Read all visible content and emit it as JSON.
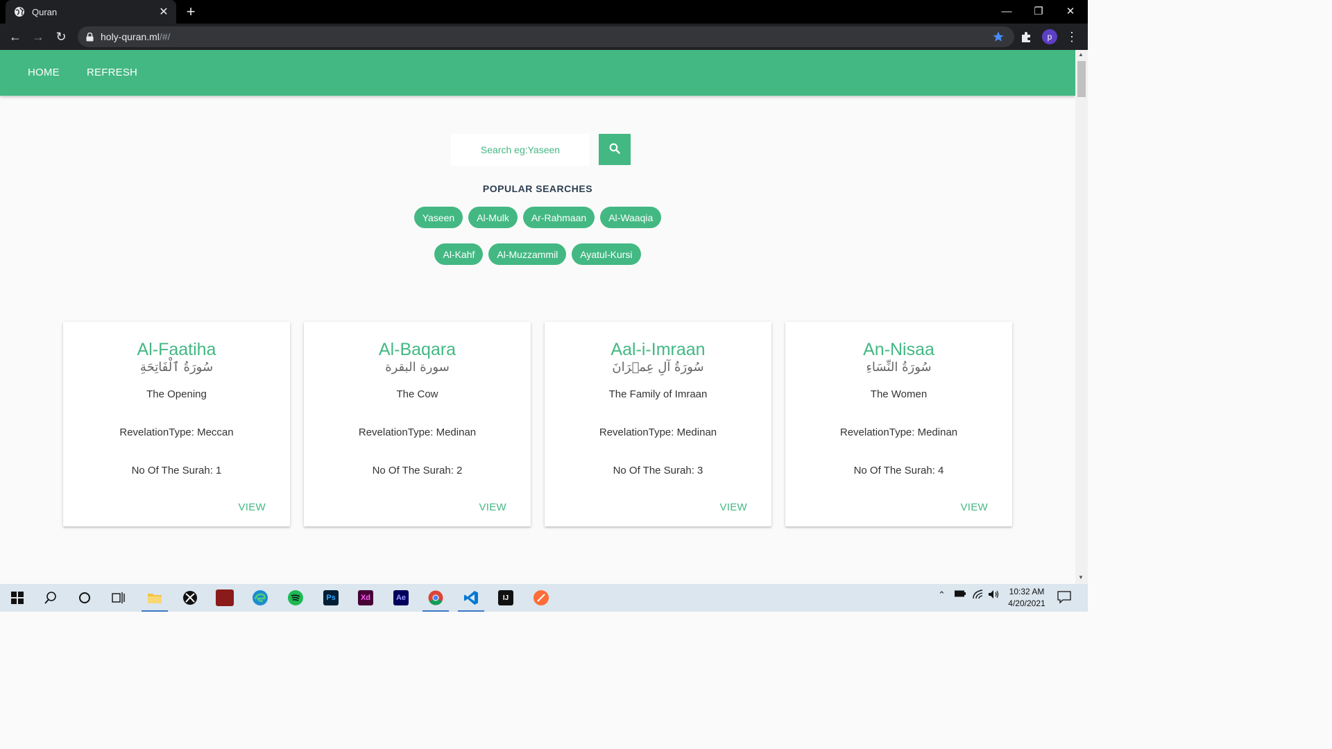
{
  "browser": {
    "tab_title": "Quran",
    "url_host": "holy-quran.ml",
    "url_path": "/#/",
    "profile_initial": "p"
  },
  "navbar": {
    "home_label": "HOME",
    "refresh_label": "REFRESH"
  },
  "search": {
    "placeholder": "Search eg:Yaseen"
  },
  "popular": {
    "title": "POPULAR SEARCHES",
    "row1": [
      "Yaseen",
      "Al-Mulk",
      "Ar-Rahmaan",
      "Al-Waaqia"
    ],
    "row2": [
      "Al-Kahf",
      "Al-Muzzammil",
      "Ayatul-Kursi"
    ]
  },
  "surahs": [
    {
      "name": "Al-Faatiha",
      "arabic": "سُورَةُ ٱلْفَاتِحَةِ",
      "meaning": "The Opening",
      "revelation": "RevelationType: Meccan",
      "number": "No Of The Surah: 1",
      "view": "VIEW"
    },
    {
      "name": "Al-Baqara",
      "arabic": "سورة البقرة",
      "meaning": "The Cow",
      "revelation": "RevelationType: Medinan",
      "number": "No Of The Surah: 2",
      "view": "VIEW"
    },
    {
      "name": "Aal-i-Imraan",
      "arabic": "سُورَةُ آلِ عِمۡرَانَ",
      "meaning": "The Family of Imraan",
      "revelation": "RevelationType: Medinan",
      "number": "No Of The Surah: 3",
      "view": "VIEW"
    },
    {
      "name": "An-Nisaa",
      "arabic": "سُورَةُ النِّسَاءِ",
      "meaning": "The Women",
      "revelation": "RevelationType: Medinan",
      "number": "No Of The Surah: 4",
      "view": "VIEW"
    }
  ],
  "taskbar": {
    "time": "10:32 AM",
    "date": "4/20/2021",
    "apps": [
      "start",
      "search",
      "cortana",
      "task-view",
      "file-explorer",
      "xbox",
      "game",
      "edge",
      "spotify",
      "photoshop",
      "xd",
      "after-effects",
      "chrome",
      "vscode",
      "intellij",
      "postman"
    ]
  },
  "colors": {
    "accent": "#43b883",
    "heading": "#2c3e50",
    "page_bg": "#fafafa"
  }
}
